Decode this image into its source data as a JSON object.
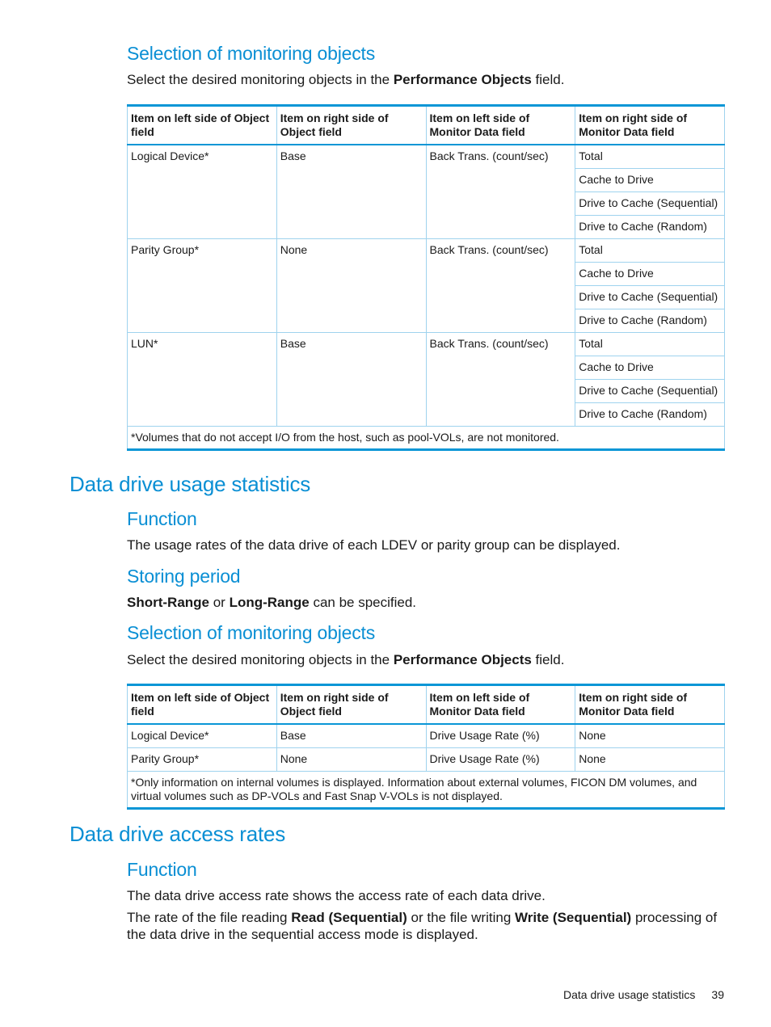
{
  "section1": {
    "heading": "Selection of monitoring objects",
    "intro": {
      "pre": "Select the desired monitoring objects in the ",
      "bold": "Performance Objects",
      "post": " field."
    },
    "table": {
      "headers": [
        "Item on left side of Object field",
        "Item on right side of Object field",
        "Item on left side of Monitor Data field",
        "Item on right side of Monitor Data field"
      ],
      "groups": [
        {
          "left_object": "Logical Device*",
          "right_object": "Base",
          "left_monitor": "Back Trans. (count/sec)",
          "right_monitor": [
            "Total",
            "Cache to Drive",
            "Drive to Cache (Sequential)",
            "Drive to Cache (Random)"
          ]
        },
        {
          "left_object": "Parity Group*",
          "right_object": "None",
          "left_monitor": "Back Trans. (count/sec)",
          "right_monitor": [
            "Total",
            "Cache to Drive",
            "Drive to Cache (Sequential)",
            "Drive to Cache (Random)"
          ]
        },
        {
          "left_object": "LUN*",
          "right_object": "Base",
          "left_monitor": "Back Trans. (count/sec)",
          "right_monitor": [
            "Total",
            "Cache to Drive",
            "Drive to Cache (Sequential)",
            "Drive to Cache (Random)"
          ]
        }
      ],
      "note": "*Volumes that do not accept I/O from the host, such as pool-VOLs, are not monitored."
    }
  },
  "section2": {
    "heading": "Data drive usage statistics",
    "function": {
      "heading": "Function",
      "text": "The usage rates of the data drive of each LDEV or parity group can be displayed."
    },
    "storing": {
      "heading": "Storing period",
      "bold1": "Short-Range",
      "mid": " or ",
      "bold2": "Long-Range",
      "post": " can be specified."
    },
    "selection": {
      "heading": "Selection of monitoring objects",
      "intro": {
        "pre": "Select the desired monitoring objects in the ",
        "bold": "Performance Objects",
        "post": " field."
      },
      "table": {
        "headers": [
          "Item on left side of Object field",
          "Item on right side of Object field",
          "Item on left side of Monitor Data field",
          "Item on right side of Monitor Data field"
        ],
        "rows": [
          [
            "Logical Device*",
            "Base",
            "Drive Usage Rate (%)",
            "None"
          ],
          [
            "Parity Group*",
            "None",
            "Drive Usage Rate (%)",
            "None"
          ]
        ],
        "note": "*Only information on internal volumes is displayed. Information about external volumes, FICON DM volumes, and virtual volumes such as DP-VOLs and Fast Snap V-VOLs is not displayed."
      }
    }
  },
  "section3": {
    "heading": "Data drive access rates",
    "function": {
      "heading": "Function",
      "text1": "The data drive access rate shows the access rate of each data drive.",
      "text2": {
        "pre": "The rate of the file reading ",
        "bold1": "Read (Sequential)",
        "mid": " or the file writing ",
        "bold2": "Write (Sequential)",
        "post": " processing of the data drive in the sequential access mode is displayed."
      }
    }
  },
  "footer": {
    "section": "Data drive usage statistics",
    "page": "39"
  }
}
